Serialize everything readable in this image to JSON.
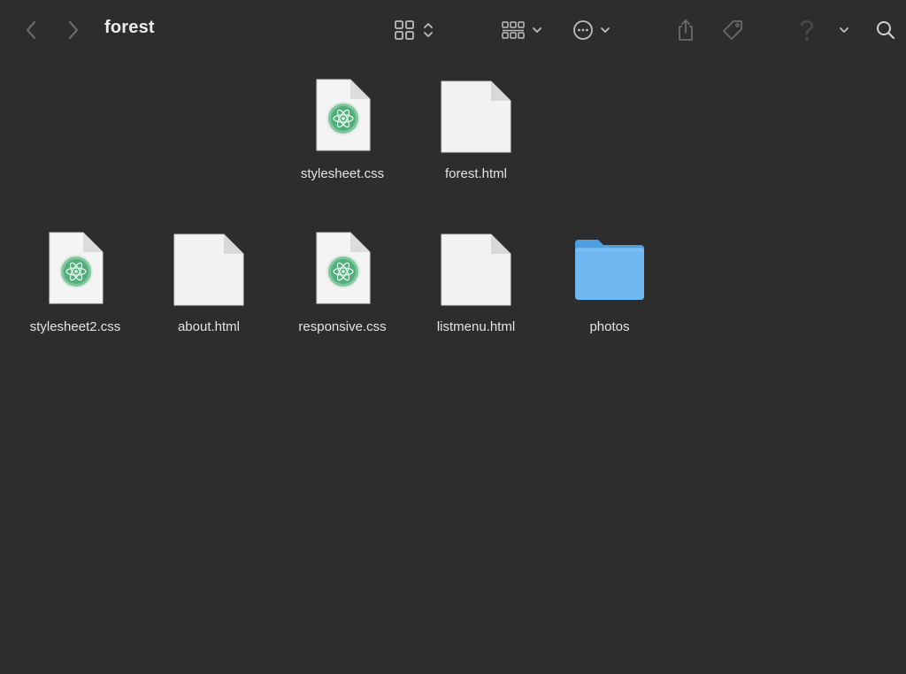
{
  "window": {
    "title": "forest"
  },
  "toolbar": {
    "icons": [
      "chevron-left-icon",
      "chevron-right-icon",
      "icon-view-grid-icon",
      "updown-chevron-icon",
      "group-by-icon",
      "chevron-down-icon",
      "more-actions-icon",
      "chevron-down-icon",
      "share-icon",
      "tag-icon",
      "help-icon",
      "chevron-down-icon",
      "search-icon"
    ]
  },
  "files": [
    {
      "name": "stylesheet.css",
      "kind": "css"
    },
    {
      "name": "forest.html",
      "kind": "html"
    },
    {
      "name": "stylesheet2.css",
      "kind": "css"
    },
    {
      "name": "about.html",
      "kind": "html"
    },
    {
      "name": "responsive.css",
      "kind": "css"
    },
    {
      "name": "listmenu.html",
      "kind": "html"
    },
    {
      "name": "photos",
      "kind": "folder"
    }
  ],
  "colors": {
    "background": "#2d2d2d",
    "folder": "#6fb8f2",
    "atom_green": "#4fae7a"
  }
}
